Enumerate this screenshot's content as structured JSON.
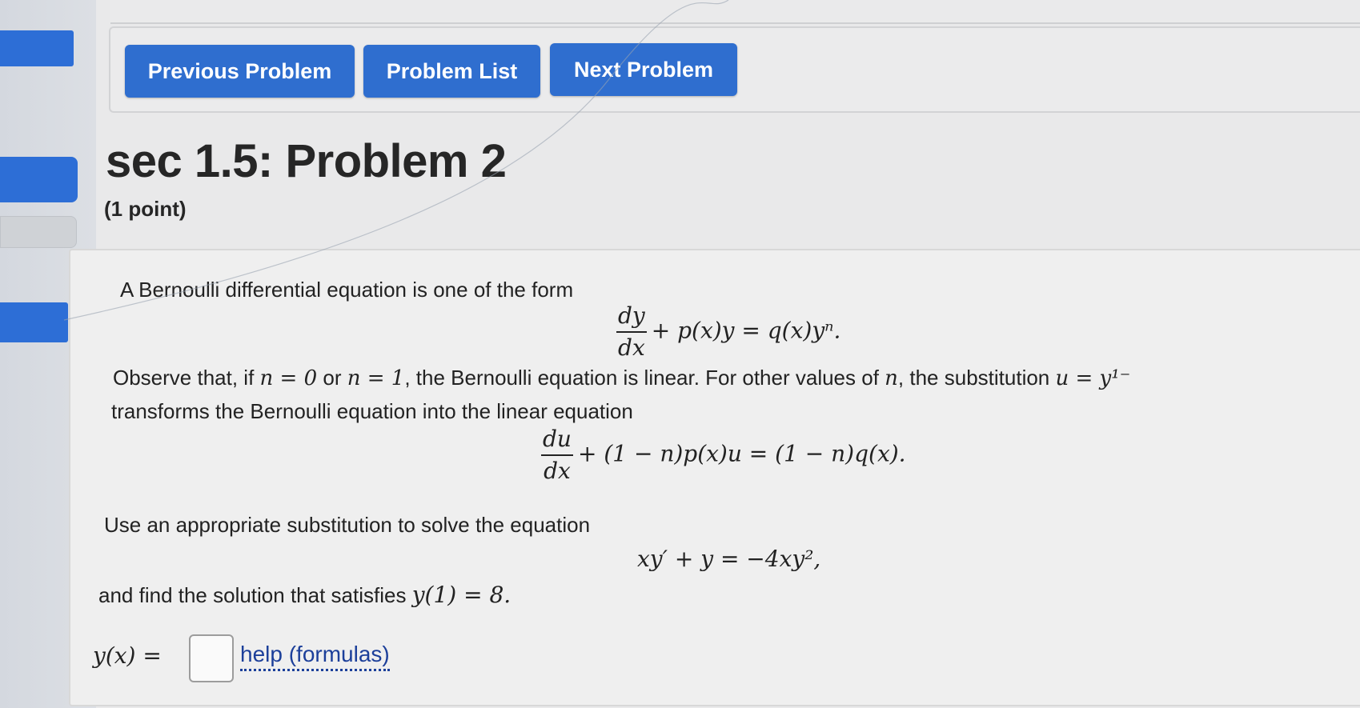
{
  "nav": {
    "previous_label": "Previous Problem",
    "list_label": "Problem List",
    "next_label": "Next Problem"
  },
  "problem": {
    "title": "sec 1.5: Problem 2",
    "points": "(1 point)",
    "intro": "A Bernoulli differential equation is one of the form",
    "eq1": {
      "num": "dy",
      "den": "dx",
      "rest": "+ p(x)y = q(x)yⁿ."
    },
    "observe": {
      "p1": "Observe that, if",
      "m1": "n = 0",
      "p2": "or",
      "m2": "n = 1",
      "p3": ", the Bernoulli equation is linear. For other values of",
      "m3": "n",
      "p4": ", the substitution",
      "m4": "u = y¹⁻"
    },
    "transforms": "transforms the Bernoulli equation into the linear equation",
    "eq2": {
      "num": "du",
      "den": "dx",
      "rest": "+ (1 − n)p(x)u = (1 − n)q(x)."
    },
    "use": "Use an appropriate substitution to solve the equation",
    "eq3": "xy′ + y = −4xy²,",
    "find": {
      "text": "and find the solution that satisfies",
      "cond": "y(1) = 8."
    },
    "answer_label": "y(x) =",
    "answer_value": "",
    "help_label": "help (formulas)"
  }
}
